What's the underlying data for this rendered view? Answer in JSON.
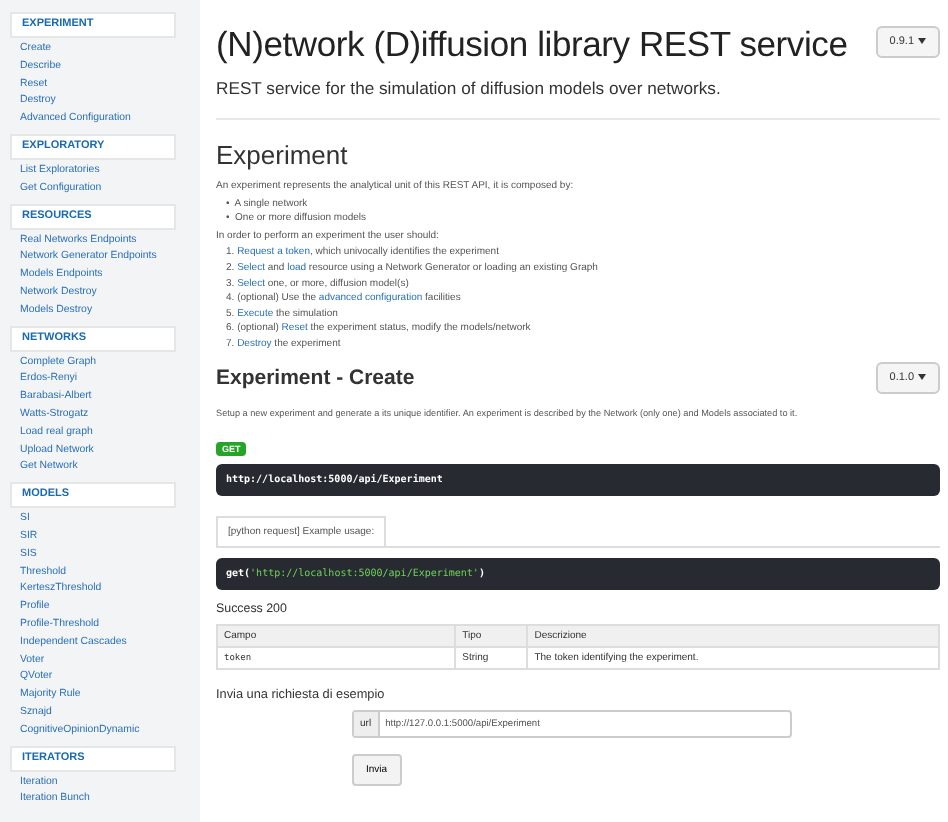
{
  "sidebar": {
    "sections": [
      {
        "title": "EXPERIMENT",
        "items": [
          "Create",
          "Describe",
          "Reset",
          "Destroy",
          "Advanced Configuration"
        ]
      },
      {
        "title": "EXPLORATORY",
        "items": [
          "List Exploratories",
          "Get Configuration"
        ]
      },
      {
        "title": "RESOURCES",
        "items": [
          "Real Networks Endpoints",
          "Network Generator Endpoints",
          "Models Endpoints",
          "Network Destroy",
          "Models Destroy"
        ]
      },
      {
        "title": "NETWORKS",
        "items": [
          "Complete Graph",
          "Erdos-Renyi",
          "Barabasi-Albert",
          "Watts-Strogatz",
          "Load real graph",
          "Upload Network",
          "Get Network"
        ]
      },
      {
        "title": "MODELS",
        "items": [
          "SI",
          "SIR",
          "SIS",
          "Threshold",
          "KerteszThreshold",
          "Profile",
          "Profile-Threshold",
          "Independent Cascades",
          "Voter",
          "QVoter",
          "Majority Rule",
          "Sznajd",
          "CognitiveOpinionDynamic"
        ]
      },
      {
        "title": "ITERATORS",
        "items": [
          "Iteration",
          "Iteration Bunch"
        ]
      }
    ]
  },
  "header": {
    "title": "(N)etwork (D)iffusion library REST service",
    "version": "0.9.1",
    "subtitle": "REST service for the simulation of diffusion models over networks."
  },
  "experiment": {
    "title": "Experiment",
    "intro": "An experiment represents the analytical unit of this REST API, it is composed by:",
    "bullets": [
      {
        "mark": "•",
        "text": "A single network"
      },
      {
        "mark": "•",
        "text": "One or more diffusion models"
      }
    ],
    "steps_intro": "In order to perform an experiment the user should:",
    "steps": [
      {
        "number": "1.",
        "parts": [
          {
            "kind": "link",
            "text": "Request a token"
          },
          {
            "kind": "plain",
            "text": ", which univocally identifies the experiment"
          }
        ]
      },
      {
        "number": "2.",
        "parts": [
          {
            "kind": "link",
            "text": "Select"
          },
          {
            "kind": "plain",
            "text": " and "
          },
          {
            "kind": "link",
            "text": "load"
          },
          {
            "kind": "plain",
            "text": " resource using a Network Generator or loading an existing Graph"
          }
        ]
      },
      {
        "number": "3.",
        "parts": [
          {
            "kind": "link",
            "text": "Select"
          },
          {
            "kind": "plain",
            "text": " one, or more, diffusion model(s)"
          }
        ]
      },
      {
        "number": "4.",
        "parts": [
          {
            "kind": "plain",
            "text": "(optional) Use the "
          },
          {
            "kind": "link",
            "text": "advanced configuration"
          },
          {
            "kind": "plain",
            "text": " facilities"
          }
        ]
      },
      {
        "number": "5.",
        "parts": [
          {
            "kind": "link",
            "text": "Execute"
          },
          {
            "kind": "plain",
            "text": " the simulation"
          }
        ]
      },
      {
        "number": "6.",
        "parts": [
          {
            "kind": "plain",
            "text": "(optional) "
          },
          {
            "kind": "link",
            "text": "Reset"
          },
          {
            "kind": "plain",
            "text": " the experiment status, modify the models/network"
          }
        ]
      },
      {
        "number": "7.",
        "parts": [
          {
            "kind": "link",
            "text": "Destroy"
          },
          {
            "kind": "plain",
            "text": " the experiment"
          }
        ]
      }
    ]
  },
  "create": {
    "title": "Experiment - Create",
    "version": "0.1.0",
    "description": "Setup a new experiment and generate a its unique identifier. An experiment is described by the Network (only one) and Models associated to it.",
    "method": "GET",
    "endpoint": "http://localhost:5000/api/Experiment",
    "example_tab": "[python request] Example usage:",
    "example_code": [
      {
        "kind": "plain",
        "text": "get("
      },
      {
        "kind": "string",
        "text": "'http://localhost:5000/api/Experiment'"
      },
      {
        "kind": "plain",
        "text": ")"
      }
    ],
    "success_title": "Success 200",
    "table": {
      "columns": [
        "Campo",
        "Tipo",
        "Descrizione"
      ],
      "rows": [
        [
          "token",
          "String",
          "The token identifying the experiment."
        ]
      ]
    },
    "sample_title": "Invia una richiesta di esempio",
    "url_label": "url",
    "url_value": "http://127.0.0.1:5000/api/Experiment",
    "send_button": "Invia"
  }
}
